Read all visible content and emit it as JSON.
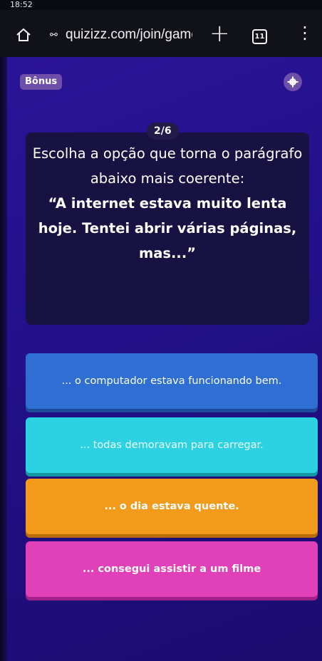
{
  "status_bar": {
    "time": "18:52"
  },
  "browser": {
    "url": "quizizz.com/join/game",
    "tab_count": "11"
  },
  "quiz": {
    "bonus_label": "Bônus",
    "counter": "2/6",
    "question": "Escolha a opção que torna o parágrafo abaixo mais coerente:",
    "quote": "“A internet estava muito lenta hoje. Tentei abrir várias páginas, mas...”",
    "answers": [
      {
        "text": "... o computador estava funcionando bem."
      },
      {
        "text": "... todas demoravam para carregar."
      },
      {
        "text": "... o dia estava quente."
      },
      {
        "text": "... consegui assistir a um filme"
      }
    ]
  },
  "colors": {
    "background": "#24118c",
    "card": "#181242",
    "answer_1": "#2f6fd4",
    "answer_2": "#2dd2e2",
    "answer_3": "#f29a1a",
    "answer_4": "#e040b8"
  }
}
